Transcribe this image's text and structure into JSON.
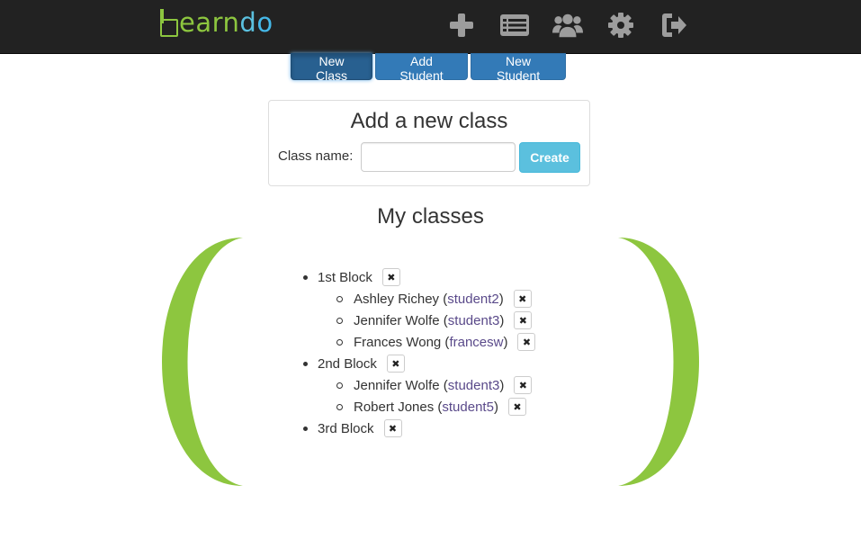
{
  "brand": {
    "part1": "earn",
    "part2": "d",
    "part3": "o",
    "box_color": "#8dc63f"
  },
  "nav": {
    "icons": [
      "plus-icon",
      "list-icon",
      "users-icon",
      "gear-icon",
      "sign-out-icon"
    ]
  },
  "toolbar": {
    "new_class_label": "New Class",
    "add_student_label": "Add Student",
    "new_student_label": "New Student"
  },
  "add_class_form": {
    "title": "Add a new class",
    "label": "Class name:",
    "input_value": "",
    "input_placeholder": "",
    "create_label": "Create"
  },
  "my_classes": {
    "title": "My classes",
    "classes": [
      {
        "name": "1st Block",
        "students": [
          {
            "name": "Ashley Richey",
            "username": "student2"
          },
          {
            "name": "Jennifer Wolfe",
            "username": "student3"
          },
          {
            "name": "Frances Wong",
            "username": "francesw"
          }
        ]
      },
      {
        "name": "2nd Block",
        "students": [
          {
            "name": "Jennifer Wolfe",
            "username": "student3"
          },
          {
            "name": "Robert Jones",
            "username": "student5"
          }
        ]
      },
      {
        "name": "3rd Block",
        "students": []
      }
    ]
  },
  "remove_glyph": "✖",
  "colors": {
    "accent_green": "#8dc63f",
    "primary_blue": "#337ab7",
    "info": "#5bc0de",
    "navbar": "#222222"
  }
}
